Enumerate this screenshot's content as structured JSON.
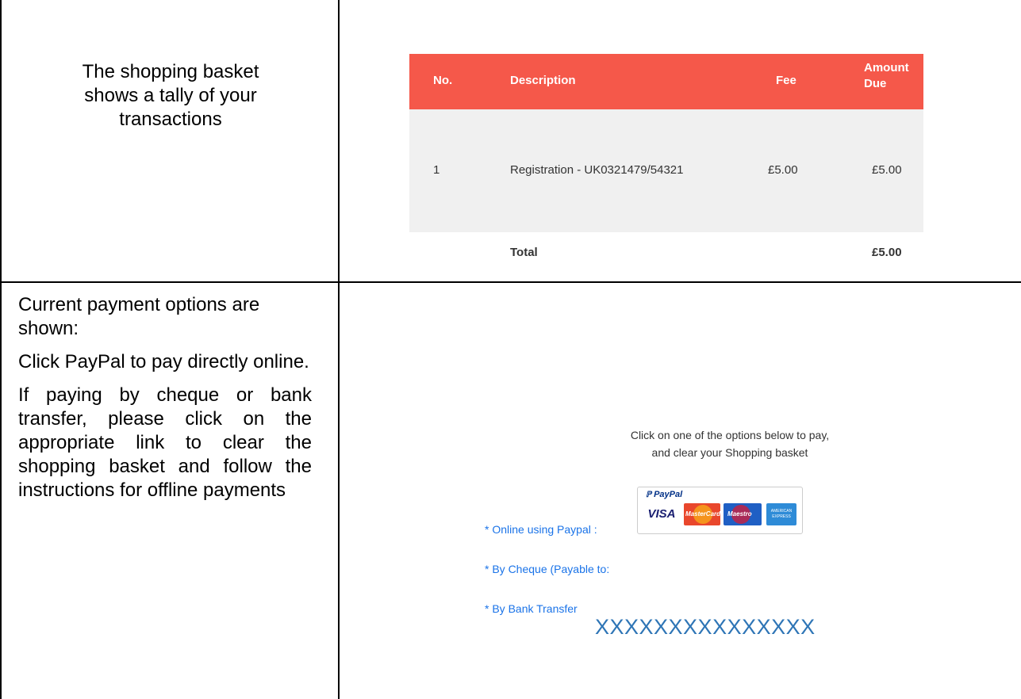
{
  "row1": {
    "intro_line1": "The shopping basket",
    "intro_line2": "shows a tally of your",
    "intro_line3": "transactions"
  },
  "basket": {
    "header_color": "#f5584a",
    "columns": [
      "No.",
      "Description",
      "Fee",
      "Amount Due"
    ],
    "amount_due_line1": "Amount",
    "amount_due_line2": "Due",
    "rows": [
      {
        "no": "1",
        "description": "Registration - UK0321479/54321",
        "fee": "£5.00",
        "amount_due": "£5.00"
      }
    ],
    "total_label": "Total",
    "total_value": "£5.00"
  },
  "row2": {
    "p1": "Current payment options are shown:",
    "p2": "Click PayPal to pay directly online.",
    "p3": "If paying by cheque or bank transfer, please click on the appropriate link to clear the shopping basket and follow the instructions for offline payments"
  },
  "payment": {
    "intro_line1": "Click on one of the options below to pay,",
    "intro_line2": "and clear your Shopping basket",
    "paypal_link": "* Online using Paypal :",
    "cheque_link": "* By Cheque (Payable to:",
    "bank_link": "* By Bank Transfer",
    "placeholder": "XXXXXXXXXXXXXXX",
    "badge": {
      "brand": "PayPal",
      "visa": "VISA",
      "mastercard": "MasterCard",
      "maestro": "Maestro",
      "amex": "AMERICAN EXPRESS"
    },
    "link_color": "#1a73e8"
  }
}
